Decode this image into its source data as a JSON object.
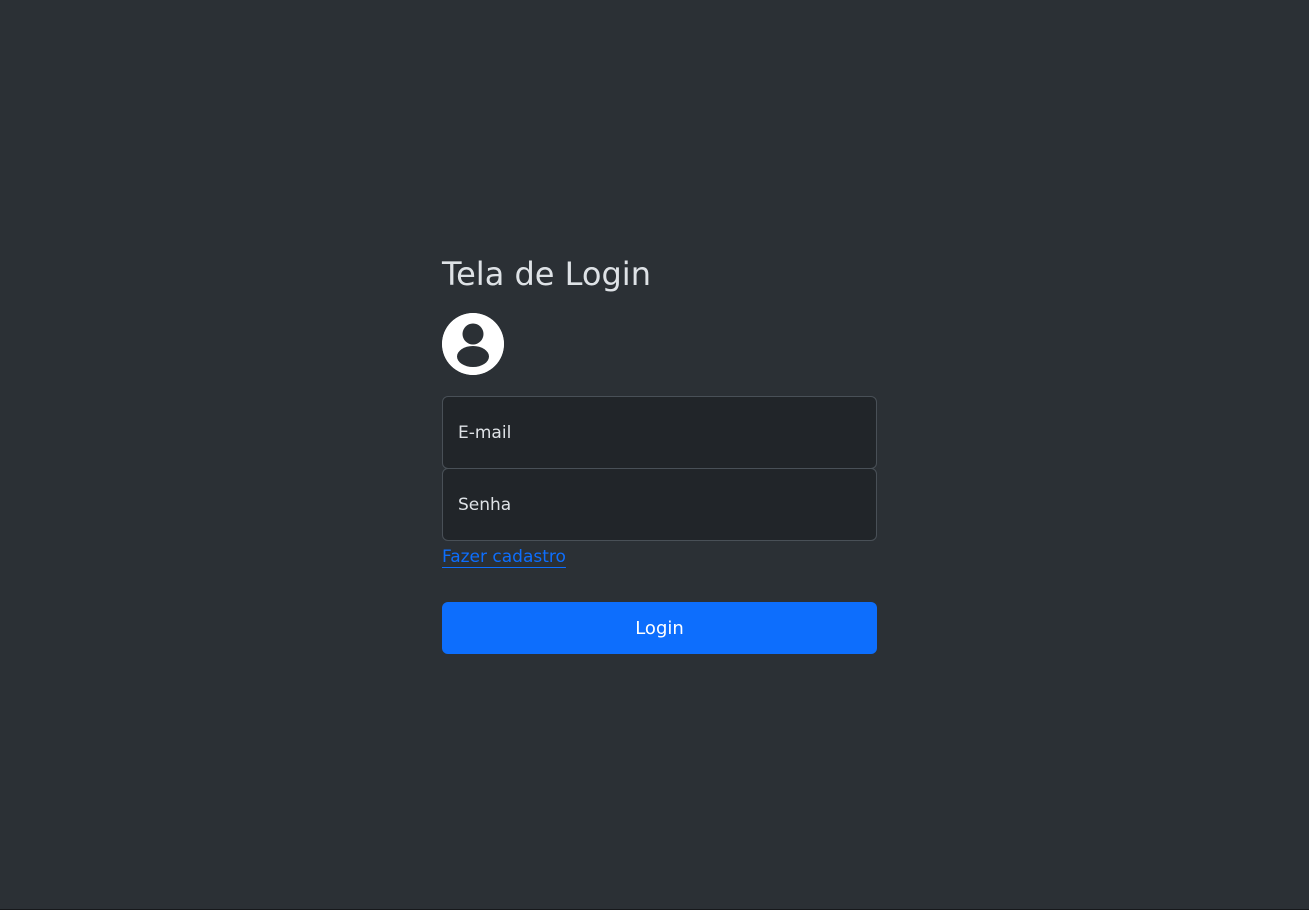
{
  "page": {
    "title": "Tela de Login"
  },
  "form": {
    "email": {
      "value": "",
      "placeholder": "E-mail"
    },
    "password": {
      "value": "",
      "placeholder": "Senha"
    },
    "register_link_text": "Fazer cadastro",
    "login_button_label": "Login"
  },
  "icons": {
    "avatar": "user-avatar-icon"
  },
  "colors": {
    "background": "#2b3035",
    "input_background": "#212529",
    "input_border": "#495057",
    "text": "#dee2e6",
    "accent": "#0d6efd",
    "button_text": "#ffffff"
  }
}
